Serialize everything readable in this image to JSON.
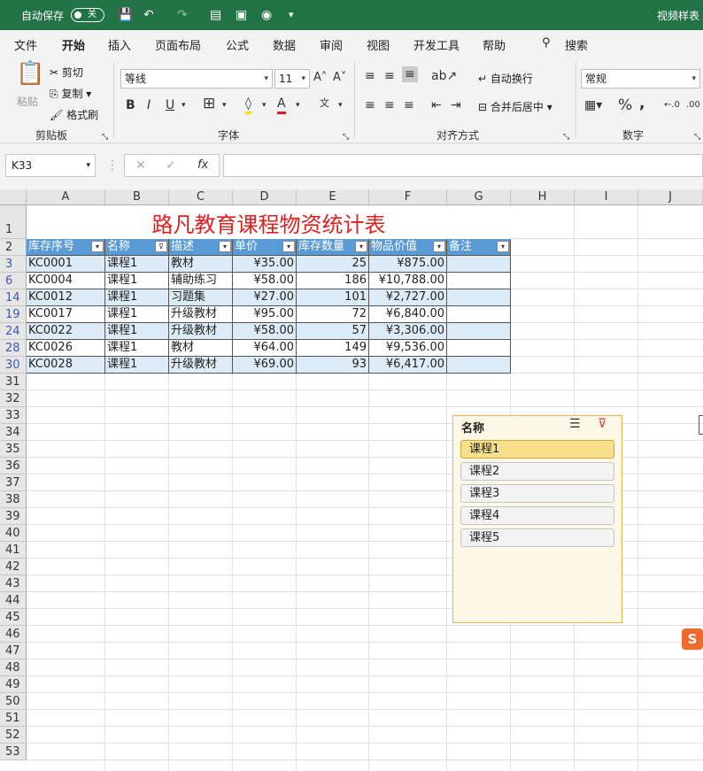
{
  "titlebar": {
    "autosave": "自动保存",
    "toggle": "关",
    "doc": "视频样表"
  },
  "tabs": [
    "文件",
    "开始",
    "插入",
    "页面布局",
    "公式",
    "数据",
    "审阅",
    "视图",
    "开发工具",
    "帮助",
    "搜索"
  ],
  "ribbon": {
    "paste": "粘贴",
    "cut": "剪切",
    "copy": "复制",
    "painter": "格式刷",
    "clip_group": "剪贴板",
    "font": "等线",
    "size": "11",
    "font_group": "字体",
    "wrap": "自动换行",
    "merge": "合并后居中",
    "align_group": "对齐方式",
    "numfmt": "常规",
    "num_group": "数字"
  },
  "formula_bar": {
    "name_box": "K33",
    "fx": "fx",
    "cancel": "✕",
    "enter": "✓"
  },
  "columns": [
    "A",
    "B",
    "C",
    "D",
    "E",
    "F",
    "G",
    "H",
    "I",
    "J"
  ],
  "table": {
    "title": "路凡教育课程物资统计表",
    "headers": [
      "库存序号",
      "名称",
      "描述",
      "单价",
      "库存数量",
      "物品价值",
      "备注"
    ],
    "rows": [
      {
        "row": "3",
        "id": "KC0001",
        "name": "课程1",
        "desc": "教材",
        "price": "¥35.00",
        "qty": "25",
        "value": "¥875.00"
      },
      {
        "row": "6",
        "id": "KC0004",
        "name": "课程1",
        "desc": "辅助练习",
        "price": "¥58.00",
        "qty": "186",
        "value": "¥10,788.00"
      },
      {
        "row": "14",
        "id": "KC0012",
        "name": "课程1",
        "desc": "习题集",
        "price": "¥27.00",
        "qty": "101",
        "value": "¥2,727.00"
      },
      {
        "row": "19",
        "id": "KC0017",
        "name": "课程1",
        "desc": "升级教材",
        "price": "¥95.00",
        "qty": "72",
        "value": "¥6,840.00"
      },
      {
        "row": "24",
        "id": "KC0022",
        "name": "课程1",
        "desc": "升级教材",
        "price": "¥58.00",
        "qty": "57",
        "value": "¥3,306.00"
      },
      {
        "row": "28",
        "id": "KC0026",
        "name": "课程1",
        "desc": "教材",
        "price": "¥64.00",
        "qty": "149",
        "value": "¥9,536.00"
      },
      {
        "row": "30",
        "id": "KC0028",
        "name": "课程1",
        "desc": "升级教材",
        "price": "¥69.00",
        "qty": "93",
        "value": "¥6,417.00"
      }
    ]
  },
  "extra_rows": [
    "1",
    "2",
    "31",
    "32",
    "33",
    "34",
    "35",
    "36",
    "37",
    "38",
    "39",
    "40",
    "41",
    "42",
    "43",
    "44",
    "45",
    "46",
    "47",
    "48",
    "49",
    "50",
    "51",
    "52",
    "53"
  ],
  "slicer": {
    "title": "名称",
    "items": [
      "课程1",
      "课程2",
      "课程3",
      "课程4",
      "课程5"
    ],
    "selected": "课程1"
  },
  "logo": "S"
}
